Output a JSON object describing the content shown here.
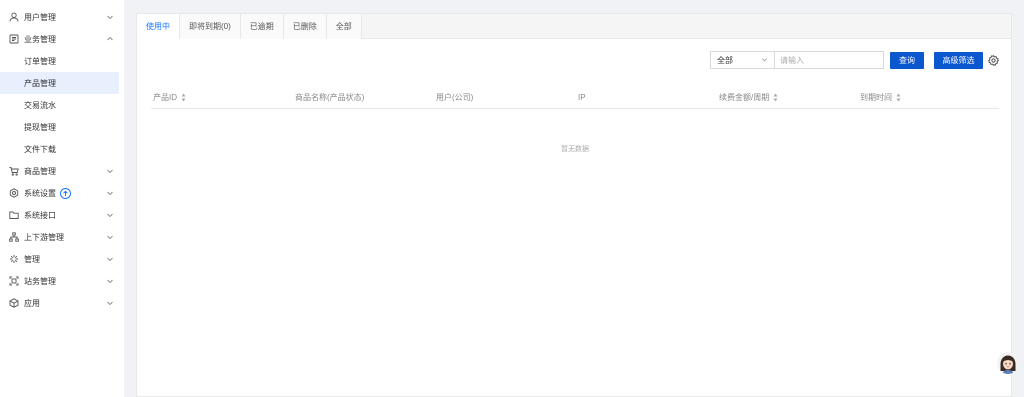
{
  "sidebar": {
    "items": [
      {
        "label": "用户管理",
        "icon": "user-icon",
        "expanded": false
      },
      {
        "label": "业务管理",
        "icon": "document-icon",
        "expanded": true,
        "children": [
          "订单管理",
          "产品管理",
          "交易流水",
          "提现管理",
          "文件下载"
        ]
      },
      {
        "label": "商品管理",
        "icon": "cart-icon",
        "expanded": false
      },
      {
        "label": "系统设置",
        "icon": "gear-icon",
        "expanded": false,
        "badge": "upgrade-icon"
      },
      {
        "label": "系统接口",
        "icon": "folder-icon",
        "expanded": false
      },
      {
        "label": "上下游管理",
        "icon": "network-icon",
        "expanded": false
      },
      {
        "label": "管理",
        "icon": "sparkle-icon",
        "expanded": false
      },
      {
        "label": "站务管理",
        "icon": "frame-icon",
        "expanded": false
      },
      {
        "label": "应用",
        "icon": "cube-icon",
        "expanded": false
      }
    ],
    "active_child": "产品管理"
  },
  "tabs": [
    {
      "label": "使用中",
      "active": true
    },
    {
      "label": "即将到期(0)",
      "active": false
    },
    {
      "label": "已逾期",
      "active": false
    },
    {
      "label": "已删除",
      "active": false
    },
    {
      "label": "全部",
      "active": false
    }
  ],
  "toolbar": {
    "select_value": "全部",
    "search_placeholder": "请输入",
    "search_button": "查询",
    "advanced_button": "高级筛选"
  },
  "table": {
    "columns": [
      "产品ID",
      "商品名称(产品状态)",
      "用户(公司)",
      "IP",
      "续费金额/周期",
      "到期时间"
    ],
    "empty_text": "暂无数据"
  },
  "colors": {
    "accent": "#0b57d0",
    "active_tab": "#1677ff",
    "active_menu_bg": "#e8f0fe"
  }
}
